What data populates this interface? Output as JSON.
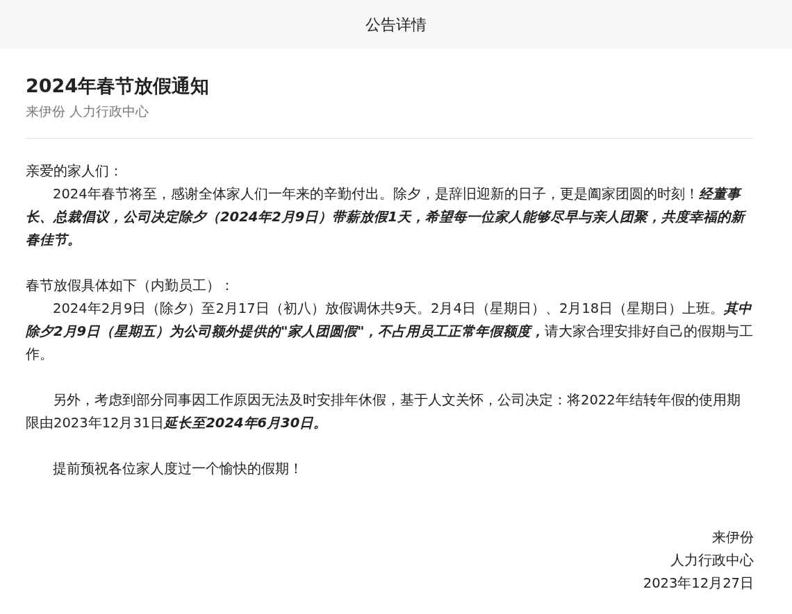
{
  "header": {
    "title": "公告详情"
  },
  "notice": {
    "title": "2024年春节放假通知",
    "source": "来伊份 人力行政中心"
  },
  "sections": [
    [
      {
        "text": "亲爱的家人们：",
        "indent": false
      },
      {
        "text": "2024年春节将至，感谢全体家人们一年来的辛勤付出。除夕，是辞旧迎新的日子，更是阖家团圆的时刻！**经董事长、总裁倡议，公司决定除夕（2024年2月9日）带薪放假1天，希望每一位家人能够尽早与亲人团聚，共度幸福的新春佳节。**",
        "indent": true
      }
    ],
    [
      {
        "text": "春节放假具体如下（内勤员工）：",
        "indent": false
      },
      {
        "text": "2024年2月9日（除夕）至2月17日（初八）放假调休共9天。2月4日（星期日）、2月18日（星期日）上班。**其中除夕2月9日（星期五）为公司额外提供的\"家人团圆假\"，不占用员工正常年假额度，**请大家合理安排好自己的假期与工作。",
        "indent": true
      }
    ],
    [
      {
        "text": "另外，考虑到部分同事因工作原因无法及时安排年休假，基于人文关怀，公司决定：将2022年结转年假的使用期限由2023年12月31日**延长至2024年6月30日。**",
        "indent": true
      }
    ],
    [
      {
        "text": "提前预祝各位家人度过一个愉快的假期！",
        "indent": true
      }
    ]
  ],
  "signature": [
    "来伊份",
    "人力行政中心",
    "2023年12月27日"
  ]
}
